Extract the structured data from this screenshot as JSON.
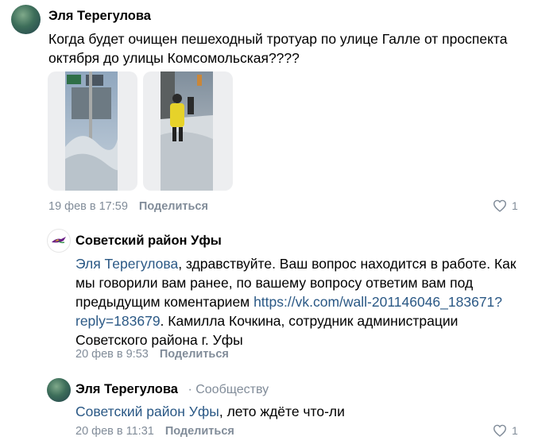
{
  "post": {
    "author": "Эля Терегулова",
    "text": "Когда будет очищен пешеходный тротуар по улице Галле от проспекта октября до улицы Комсомольская????",
    "date": "19 фев в 17:59",
    "share_label": "Поделиться",
    "likes": "1",
    "photos": [
      "street-snow-photo",
      "pedestrian-yellow-coat-photo"
    ]
  },
  "reply1": {
    "author": "Советский район Уфы",
    "mention": "Эля Терегулова",
    "text_part1": ", здравствуйте. Ваш вопрос находится в работе. Как мы говорили вам ранее, по вашему вопросу ответим вам под предыдущим коментарием ",
    "link": "https://vk.com/wall-201146046_183671?reply=183679",
    "text_part2": ". Камилла Кочкина, сотрудник администрации Советского района г. Уфы",
    "date": "20 фев в 9:53",
    "share_label": "Поделиться"
  },
  "reply2": {
    "author": "Эля Терегулова",
    "context": "· Сообществу",
    "mention": "Советский район Уфы",
    "text": ", лето ждёте что-ли",
    "date": "20 фев в 11:31",
    "share_label": "Поделиться",
    "likes": "1"
  },
  "colors": {
    "link": "#2a5885",
    "meta": "#818c99"
  }
}
